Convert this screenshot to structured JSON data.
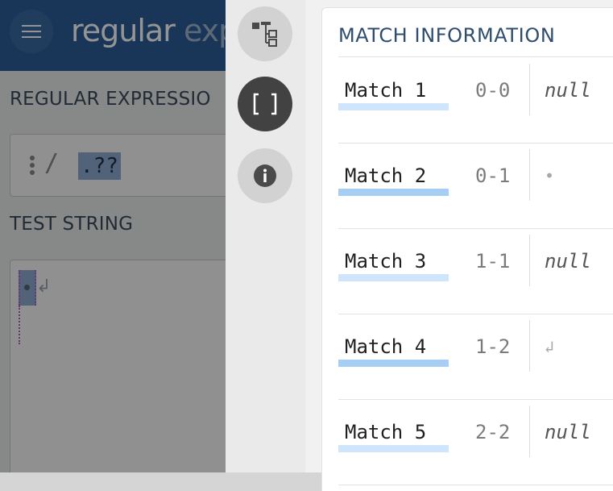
{
  "background_app": {
    "logo_primary": "regular",
    "logo_faded": "expr",
    "regex_section_label": "REGULAR EXPRESSIO",
    "regex_delimiter": "/",
    "regex_value": ".??",
    "test_section_label": "TEST STRING",
    "test_newline_glyph": "↲"
  },
  "rail": {
    "items": [
      {
        "icon": "tree-structure-icon",
        "active": false
      },
      {
        "icon": "brackets-icon",
        "label": "[ ]",
        "active": true
      },
      {
        "icon": "info-icon",
        "active": false
      }
    ]
  },
  "panel": {
    "title": "MATCH INFORMATION",
    "matches": [
      {
        "label": "Match 1",
        "range": "0-0",
        "value": "null",
        "value_kind": "null"
      },
      {
        "label": "Match 2",
        "range": "0-1",
        "value": "•",
        "value_kind": "glyph"
      },
      {
        "label": "Match 3",
        "range": "1-1",
        "value": "null",
        "value_kind": "null"
      },
      {
        "label": "Match 4",
        "range": "1-2",
        "value": "↲",
        "value_kind": "glyph"
      },
      {
        "label": "Match 5",
        "range": "2-2",
        "value": "null",
        "value_kind": "null"
      }
    ]
  },
  "colors": {
    "topbar": "#2b5c96",
    "rail_active": "#424242",
    "title": "#2f4d6e",
    "underline_light": "#cfe5fb",
    "underline_strong": "#a6cef5"
  }
}
